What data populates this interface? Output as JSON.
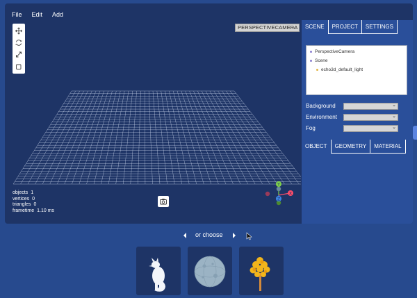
{
  "menu": {
    "file": "File",
    "edit": "Edit",
    "add": "Add"
  },
  "toolbar": {
    "translate_icon": "move-arrows-icon",
    "rotate_icon": "rotate-icon",
    "scale_icon": "scale-icon",
    "local_icon": "checkbox-icon"
  },
  "camera_select": {
    "value": "PERSPECTIVECAMERA"
  },
  "stats": {
    "objects_label": "objects",
    "objects_value": "1",
    "vertices_label": "vertices",
    "vertices_value": "0",
    "triangles_label": "triangles",
    "triangles_value": "0",
    "frametime_label": "frametime",
    "frametime_value": "1.10 ms"
  },
  "gizmo": {
    "y": "Y",
    "x": "X",
    "z": "Z"
  },
  "sidebar": {
    "tabs": [
      "SCENE",
      "PROJECT",
      "SETTINGS"
    ],
    "outliner": [
      "PerspectiveCamera",
      "Scene",
      "echo3d_default_light"
    ],
    "properties": [
      "Background",
      "Environment",
      "Fog"
    ],
    "object_tabs": [
      "OBJECT",
      "GEOMETRY",
      "MATERIAL"
    ]
  },
  "chooser": {
    "label": "or choose"
  },
  "thumbnails": [
    "arctic-fox-model",
    "moon-sphere-model",
    "autumn-tree-model"
  ],
  "colors": {
    "background": "#274a8e",
    "editor_bg": "#1e3466",
    "panel_bg": "#2a4f9a",
    "grid": "#c8d3ea",
    "gizmo_y": "#7fd14a",
    "gizmo_x": "#ff4d6a",
    "gizmo_z": "#3f86e6"
  }
}
